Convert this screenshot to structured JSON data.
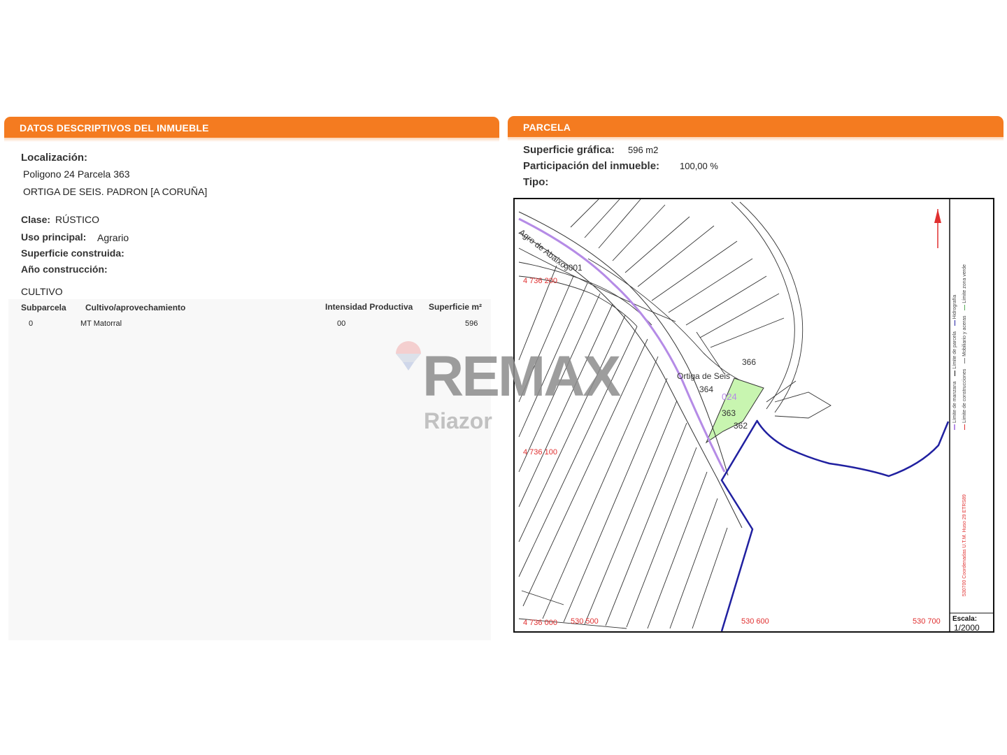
{
  "left_panel": {
    "header": "DATOS DESCRIPTIVOS DEL INMUEBLE",
    "localizacion_label": "Localización:",
    "localizacion_line1": "Poligono 24 Parcela 363",
    "localizacion_line2": "ORTIGA DE SEIS. PADRON [A CORUÑA]",
    "clase_label": "Clase:",
    "clase_value": "RÚSTICO",
    "uso_label": "Uso principal:",
    "uso_value": "Agrario",
    "superficie_label": "Superficie construida:",
    "anio_label": "Año construcción:",
    "cultivo_title": "CULTIVO",
    "table": {
      "headers": [
        "Subparcela",
        "Cultivo/aprovechamiento",
        "Intensidad Productiva",
        "Superficie m²"
      ],
      "rows": [
        [
          "0",
          "MT Matorral",
          "00",
          "596"
        ]
      ]
    }
  },
  "right_panel": {
    "header": "PARCELA",
    "sup_grafica_label": "Superficie gráfica:",
    "sup_grafica_value": "596 m2",
    "participacion_label": "Participación del inmueble:",
    "participacion_value": "100,00 %",
    "tipo_label": "Tipo:"
  },
  "map": {
    "road_label": "Agro de Abaixo",
    "place_label": "Ortiga de Seis",
    "parcels": [
      "9001",
      "366",
      "364",
      "024",
      "363",
      "362"
    ],
    "coords": [
      "4 736 200",
      "4 736 100",
      "4 736 000",
      "530 500",
      "530 600",
      "530 700"
    ],
    "legend": [
      "Límite de manzana",
      "Límite de parcela",
      "Hidrografía",
      "Límite de construcciones",
      "Mobiliario y aceras",
      "Límite zona verde"
    ],
    "projection_note": "530700 Coordenadas U.T.M. Huso 29 ETRS89",
    "scale_label": "Escala:",
    "scale_value": "1/2000",
    "colors": {
      "road": "#b58be6",
      "hydro": "#2020a0",
      "parcel_fill": "#c8f5b0",
      "coord": "#e03030"
    }
  },
  "watermark": {
    "brand": "REMAX",
    "office": "Riazor"
  }
}
